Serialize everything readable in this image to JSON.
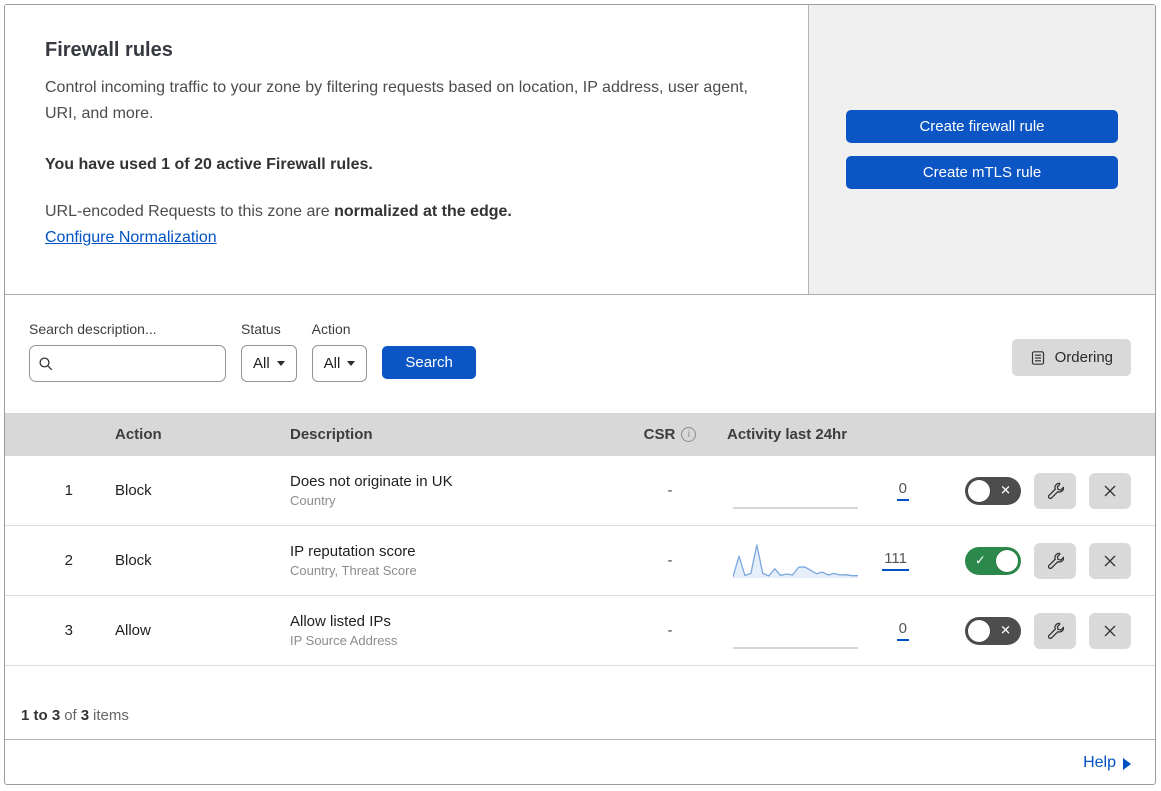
{
  "header": {
    "title": "Firewall rules",
    "description": "Control incoming traffic to your zone by filtering requests based on location, IP address, user agent, URI, and more.",
    "usage": "You have used 1 of 20 active Firewall rules.",
    "normalization_text": "URL-encoded Requests to this zone are ",
    "normalization_bold": "normalized at the edge.",
    "normalization_link": "Configure Normalization",
    "create_firewall_button": "Create firewall rule",
    "create_mtls_button": "Create mTLS rule"
  },
  "filters": {
    "search_label": "Search description...",
    "search_value": "",
    "status_label": "Status",
    "status_value": "All",
    "action_label": "Action",
    "action_value": "All",
    "search_button": "Search",
    "ordering_button": "Ordering"
  },
  "table": {
    "columns": {
      "action": "Action",
      "description": "Description",
      "csr": "CSR",
      "activity": "Activity last 24hr"
    },
    "rows": [
      {
        "number": "1",
        "action": "Block",
        "title": "Does not originate in UK",
        "subtitle": "Country",
        "csr": "-",
        "count": "0",
        "enabled": false,
        "activity_sparkline": null
      },
      {
        "number": "2",
        "action": "Block",
        "title": "IP reputation score",
        "subtitle": "Country, Threat Score",
        "csr": "-",
        "count": "111",
        "enabled": true,
        "activity_sparkline": [
          4,
          66,
          8,
          14,
          100,
          14,
          6,
          28,
          8,
          12,
          9,
          32,
          34,
          24,
          13,
          18,
          9,
          14,
          9,
          10,
          7,
          7
        ]
      },
      {
        "number": "3",
        "action": "Allow",
        "title": "Allow listed IPs",
        "subtitle": "IP Source Address",
        "csr": "-",
        "count": "0",
        "enabled": false,
        "activity_sparkline": null
      }
    ]
  },
  "footer": {
    "range": "1 to 3",
    "of": "of",
    "total": "3",
    "items_label": "items",
    "help": "Help"
  },
  "colors": {
    "blue": "#0b55c4",
    "link-blue": "#0051c3",
    "green": "#2b8a4b",
    "toggle-off": "#4d4d4d",
    "panel-gray": "#f0f0f0",
    "header-gray": "#d8d8d8",
    "button-gray": "#d9d9d9",
    "spark-line": "#7aa7e0",
    "spark-fill": "#e6eef9"
  }
}
